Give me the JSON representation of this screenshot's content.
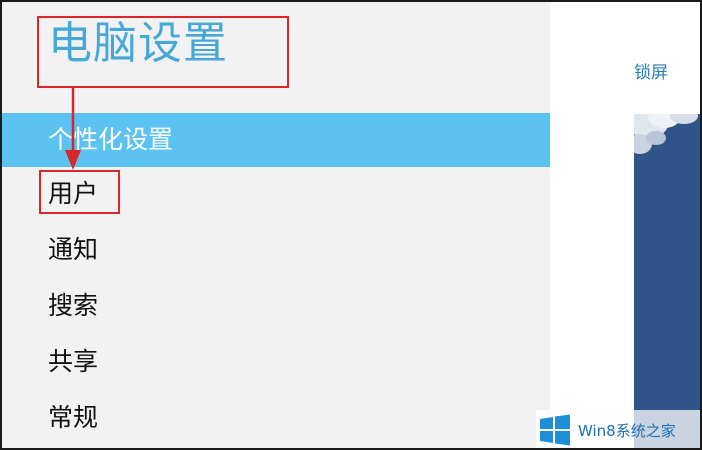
{
  "app": {
    "title": "电脑设置"
  },
  "sidebar": {
    "items": [
      {
        "label": "个性化设置",
        "selected": true
      },
      {
        "label": "用户",
        "selected": false
      },
      {
        "label": "通知",
        "selected": false
      },
      {
        "label": "搜索",
        "selected": false
      },
      {
        "label": "共享",
        "selected": false
      },
      {
        "label": "常规",
        "selected": false
      }
    ]
  },
  "content": {
    "tab_label": "锁屏"
  },
  "annotation": {
    "color": "#d9262b"
  },
  "theme": {
    "accent": "#5bc2f2",
    "title_color": "#45a8d6",
    "preview_color": "#2f5489"
  },
  "watermark": {
    "text": "Win8系统之家",
    "icon": "windows-logo-icon"
  }
}
